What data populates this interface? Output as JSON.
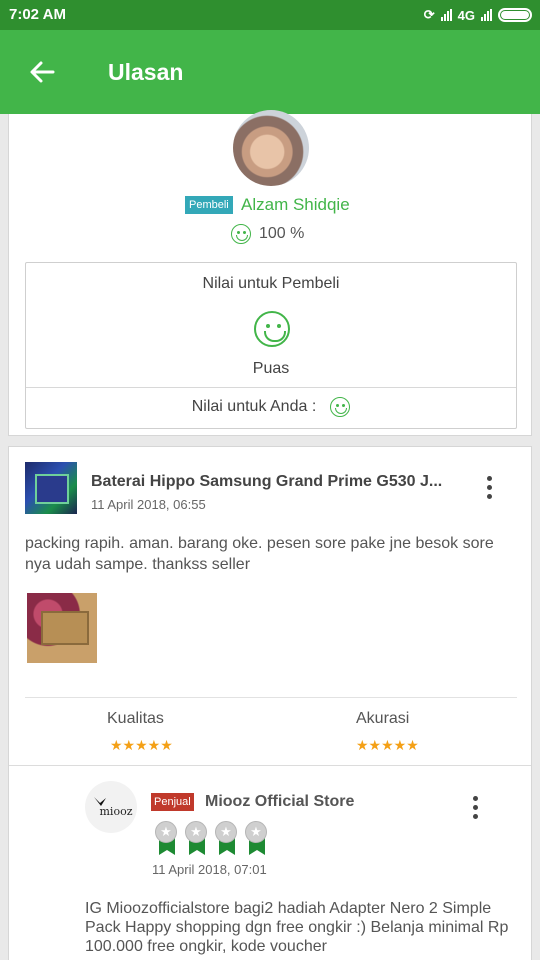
{
  "status_bar": {
    "time": "7:02 AM",
    "network": "4G"
  },
  "app_bar": {
    "title": "Ulasan",
    "back_icon": "arrow-left-icon"
  },
  "buyer_section": {
    "badge": "Pembeli",
    "name": "Alzam Shidqie",
    "reputation": "100 %",
    "rating_title": "Nilai untuk Pembeli",
    "rating_value": "Puas",
    "your_rating_label": "Nilai untuk Anda :"
  },
  "review": {
    "product_name": "Baterai Hippo Samsung Grand Prime G530 J...",
    "date": "11 April 2018, 06:55",
    "text": "packing rapih. aman. barang oke. pesen sore pake jne besok sore nya udah sampe. thankss seller",
    "quality_label": "Kualitas",
    "quality_stars": 5,
    "accuracy_label": "Akurasi",
    "accuracy_stars": 5,
    "star_glyphs": "★★★★★"
  },
  "seller_reply": {
    "logo_text": "miooz",
    "badge": "Penjual",
    "name": "Miooz Official Store",
    "medal_count": 4,
    "date": "11 April 2018, 07:01",
    "text": "IG Mioozofficialstore bagi2 hadiah Adapter Nero 2 Simple Pack Happy shopping dgn free ongkir :) Belanja minimal Rp 100.000 free ongkir, kode voucher"
  },
  "colors": {
    "primary": "#42b549",
    "status_bar": "#2f8f2f",
    "buyer_badge": "#33a8b8",
    "seller_badge": "#c0392b",
    "star": "#f4a016"
  }
}
